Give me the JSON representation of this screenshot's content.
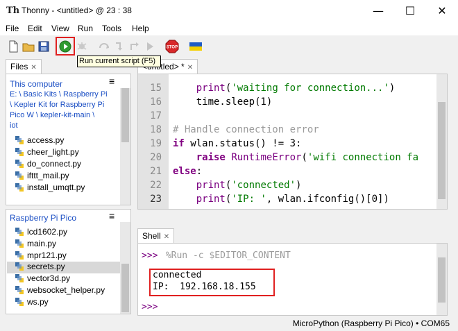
{
  "window": {
    "title": "Thonny  -  <untitled>  @  23 : 38",
    "app_icon_text": "Th",
    "minimize": "—",
    "maximize": "☐",
    "close": "✕"
  },
  "menu": [
    "File",
    "Edit",
    "View",
    "Run",
    "Tools",
    "Help"
  ],
  "toolbar": {
    "tooltip": "Run current script (F5)",
    "stop_label": "STOP"
  },
  "files_panel": {
    "tab_label": "Files",
    "this_computer": {
      "heading": "This computer",
      "path_lines": [
        "E: \\ Basic Kits \\ Raspberry Pi",
        "\\ Kepler Kit for Raspberry Pi",
        "Pico W \\ kepler-kit-main \\",
        "iot"
      ],
      "files": [
        "access.py",
        "cheer_light.py",
        "do_connect.py",
        "ifttt_mail.py",
        "install_umqtt.py"
      ]
    },
    "pico": {
      "heading": "Raspberry Pi Pico",
      "files": [
        "lcd1602.py",
        "main.py",
        "mpr121.py",
        "secrets.py",
        "vector3d.py",
        "websocket_helper.py",
        "ws.py"
      ],
      "selected": "secrets.py"
    },
    "menu_icon": "≡"
  },
  "editor": {
    "tab_label": "<untitled> *",
    "line_numbers": [
      "15",
      "16",
      "17",
      "18",
      "19",
      "20",
      "21",
      "22",
      "23"
    ]
  },
  "shell": {
    "tab_label": "Shell",
    "prompt": ">>>",
    "command": " %Run -c $EDITOR_CONTENT",
    "output": [
      "connected",
      "IP:  192.168.18.155"
    ]
  },
  "status": {
    "text": "MicroPython (Raspberry Pi Pico)  •  COM65"
  },
  "colors": {
    "highlight_red": "#e02020",
    "keyword": "#800080",
    "string": "#007a00",
    "comment": "#9b9b9b",
    "link": "#1a4ec4"
  }
}
